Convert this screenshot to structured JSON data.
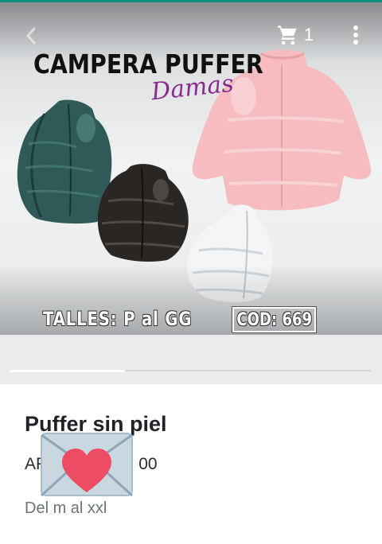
{
  "header": {
    "back_icon": "chevron-left-icon",
    "cart_icon": "shopping-cart-icon",
    "cart_count": "1",
    "menu_icon": "vertical-dots-icon"
  },
  "hero": {
    "promo_title": "CAMPERA PUFFER",
    "promo_subtitle": "Damas",
    "sizes_text": "TALLES: P al GG",
    "code_text": "COD: 669",
    "jacket_colors": [
      "#2f5a57",
      "#2a2623",
      "#f6bcc0",
      "#f3f5f7"
    ]
  },
  "gallery": {
    "progress_fraction": 0.32
  },
  "product": {
    "name": "Puffer sin piel",
    "price_visible_left": "AR",
    "price_visible_right": "00",
    "description": "Del m al xxl"
  },
  "overlay": {
    "sticker_icon": "envelope-heart-icon"
  },
  "colors": {
    "accent_line": "#128c7e",
    "heart": "#ec4c64",
    "envelope": "#c9d7e1"
  }
}
